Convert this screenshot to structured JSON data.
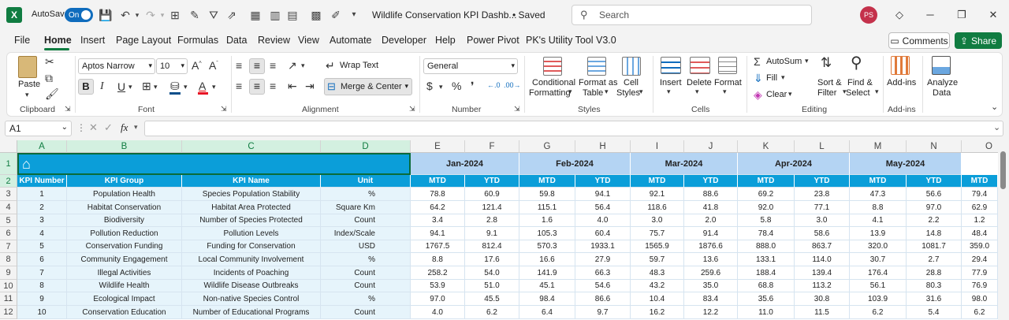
{
  "titlebar": {
    "autosave_label": "AutoSave",
    "autosave_state": "On",
    "doc_title": "Wildlife Conservation KPI Dashb...",
    "saved": "• Saved",
    "search_placeholder": "Search",
    "user_initials": "PS"
  },
  "menu": {
    "items": [
      "File",
      "Home",
      "Insert",
      "Page Layout",
      "Formulas",
      "Data",
      "Review",
      "View",
      "Automate",
      "Developer",
      "Help",
      "Power Pivot",
      "PK's Utility Tool V3.0"
    ],
    "active": "Home",
    "comments": "Comments",
    "share": "Share"
  },
  "ribbon": {
    "groups": {
      "clipboard": "Clipboard",
      "font": "Font",
      "alignment": "Alignment",
      "number": "Number",
      "styles": "Styles",
      "cells": "Cells",
      "editing": "Editing",
      "addins": "Add-ins"
    },
    "paste": "Paste",
    "font_name": "Aptos Narrow",
    "font_size": "10",
    "wrap_text": "Wrap Text",
    "merge_center": "Merge & Center",
    "number_format": "General",
    "conditional_formatting": [
      "Conditional",
      "Formatting"
    ],
    "format_as_table": [
      "Format as",
      "Table"
    ],
    "cell_styles": [
      "Cell",
      "Styles"
    ],
    "insert": "Insert",
    "delete": "Delete",
    "format": "Format",
    "autosum": "AutoSum",
    "fill": "Fill",
    "clear": "Clear",
    "sort_filter": [
      "Sort &",
      "Filter"
    ],
    "find_select": [
      "Find &",
      "Select"
    ],
    "addins": "Add-ins",
    "analyze_data": [
      "Analyze",
      "Data"
    ]
  },
  "formula_bar": {
    "name_box": "A1",
    "fx": "fx",
    "content": ""
  },
  "sheet": {
    "columns": [
      "A",
      "B",
      "C",
      "D",
      "E",
      "F",
      "G",
      "H",
      "I",
      "J",
      "K",
      "L",
      "M",
      "N",
      "O"
    ],
    "rows": [
      "1",
      "2",
      "3",
      "4",
      "5",
      "6",
      "7",
      "8",
      "9",
      "10",
      "11",
      "12"
    ],
    "months": [
      "Jan-2024",
      "Feb-2024",
      "Mar-2024",
      "Apr-2024",
      "May-2024"
    ],
    "headers": [
      "KPI Number",
      "KPI Group",
      "KPI Name",
      "Unit"
    ],
    "mtd": "MTD",
    "ytd": "YTD",
    "kpis": [
      {
        "num": "1",
        "group": "Population Health",
        "name": "Species Population Stability",
        "unit": "%",
        "vals": [
          "78.8",
          "60.9",
          "59.8",
          "94.1",
          "92.1",
          "88.6",
          "69.2",
          "23.8",
          "47.3",
          "56.6",
          "79.4"
        ]
      },
      {
        "num": "2",
        "group": "Habitat Conservation",
        "name": "Habitat Area Protected",
        "unit": "Square Km",
        "vals": [
          "64.2",
          "121.4",
          "115.1",
          "56.4",
          "118.6",
          "41.8",
          "92.0",
          "77.1",
          "8.8",
          "97.0",
          "62.9"
        ]
      },
      {
        "num": "3",
        "group": "Biodiversity",
        "name": "Number of Species Protected",
        "unit": "Count",
        "vals": [
          "3.4",
          "2.8",
          "1.6",
          "4.0",
          "3.0",
          "2.0",
          "5.8",
          "3.0",
          "4.1",
          "2.2",
          "1.2"
        ]
      },
      {
        "num": "4",
        "group": "Pollution Reduction",
        "name": "Pollution Levels",
        "unit": "Index/Scale",
        "vals": [
          "94.1",
          "9.1",
          "105.3",
          "60.4",
          "75.7",
          "91.4",
          "78.4",
          "58.6",
          "13.9",
          "14.8",
          "48.4"
        ]
      },
      {
        "num": "5",
        "group": "Conservation Funding",
        "name": "Funding for Conservation",
        "unit": "USD",
        "vals": [
          "1767.5",
          "812.4",
          "570.3",
          "1933.1",
          "1565.9",
          "1876.6",
          "888.0",
          "863.7",
          "320.0",
          "1081.7",
          "359.0"
        ]
      },
      {
        "num": "6",
        "group": "Community Engagement",
        "name": "Local Community Involvement",
        "unit": "%",
        "vals": [
          "8.8",
          "17.6",
          "16.6",
          "27.9",
          "59.7",
          "13.6",
          "133.1",
          "114.0",
          "30.7",
          "2.7",
          "29.4"
        ]
      },
      {
        "num": "7",
        "group": "Illegal Activities",
        "name": "Incidents of Poaching",
        "unit": "Count",
        "vals": [
          "258.2",
          "54.0",
          "141.9",
          "66.3",
          "48.3",
          "259.6",
          "188.4",
          "139.4",
          "176.4",
          "28.8",
          "77.9"
        ]
      },
      {
        "num": "8",
        "group": "Wildlife Health",
        "name": "Wildlife Disease Outbreaks",
        "unit": "Count",
        "vals": [
          "53.9",
          "51.0",
          "45.1",
          "54.6",
          "43.2",
          "35.0",
          "68.8",
          "113.2",
          "56.1",
          "80.3",
          "76.9"
        ]
      },
      {
        "num": "9",
        "group": "Ecological Impact",
        "name": "Non-native Species Control",
        "unit": "%",
        "vals": [
          "97.0",
          "45.5",
          "98.4",
          "86.6",
          "10.4",
          "83.4",
          "35.6",
          "30.8",
          "103.9",
          "31.6",
          "98.0"
        ]
      },
      {
        "num": "10",
        "group": "Conservation Education",
        "name": "Number of Educational Programs",
        "unit": "Count",
        "vals": [
          "4.0",
          "6.2",
          "6.4",
          "9.7",
          "16.2",
          "12.2",
          "11.0",
          "11.5",
          "6.2",
          "5.4",
          "6.2"
        ]
      }
    ]
  },
  "colors": {
    "excel_green": "#107c41",
    "header_blue": "#0b9ed9",
    "month_band": "#b4d4f3",
    "data_light": "#e6f4fb"
  }
}
